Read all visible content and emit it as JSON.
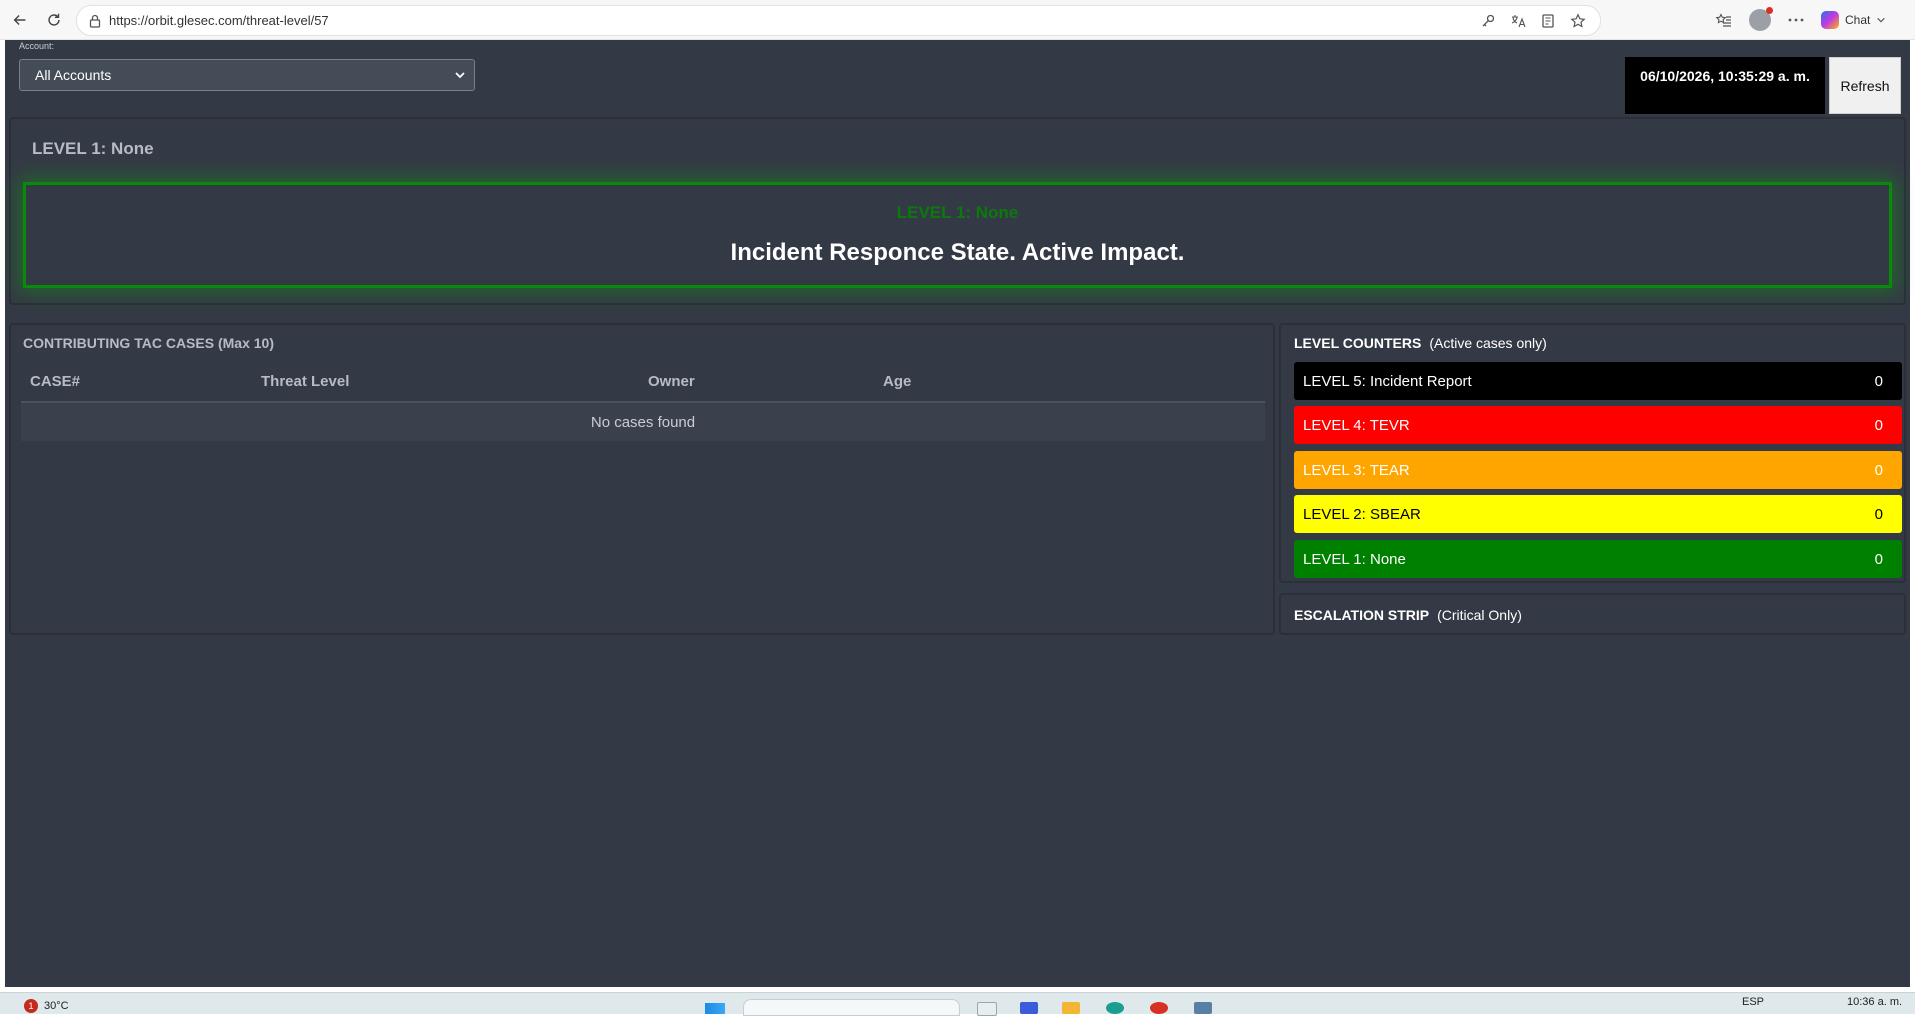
{
  "browser": {
    "url": "https://orbit.glesec.com/threat-level/57",
    "chat_label": "Chat"
  },
  "account": {
    "label": "Account:",
    "selected": "All Accounts"
  },
  "header": {
    "datetime": "06/10/2026, 10:35:29 a. m.",
    "refresh_label": "Refresh"
  },
  "level_panel": {
    "title": "LEVEL 1: None",
    "box_level": "LEVEL 1: None",
    "state_text": "Incident Responce State. Active Impact.",
    "accent_color": "#0a8a0a"
  },
  "cases": {
    "title": "CONTRIBUTING TAC CASES (Max 10)",
    "columns": [
      "CASE#",
      "Threat Level",
      "Owner",
      "Age"
    ],
    "empty_text": "No cases found"
  },
  "counters": {
    "title": "LEVEL COUNTERS",
    "subtitle": "(Active cases only)",
    "rows": [
      {
        "label": "LEVEL 5: Incident Report",
        "count": "0",
        "bg": "#000000",
        "fg": "#ffffff"
      },
      {
        "label": "LEVEL 4: TEVR",
        "count": "0",
        "bg": "#ff0000",
        "fg": "#ffffff"
      },
      {
        "label": "LEVEL 3: TEAR",
        "count": "0",
        "bg": "#ffa500",
        "fg": "#ffffff"
      },
      {
        "label": "LEVEL 2: SBEAR",
        "count": "0",
        "bg": "#ffff00",
        "fg": "#000000"
      },
      {
        "label": "LEVEL 1: None",
        "count": "0",
        "bg": "#008000",
        "fg": "#ffffff"
      }
    ]
  },
  "escalation": {
    "title": "ESCALATION STRIP",
    "subtitle": "(Critical Only)"
  },
  "taskbar": {
    "notification_count": "1",
    "temperature": "30°C",
    "language": "ESP",
    "time": "10:36 a. m."
  }
}
